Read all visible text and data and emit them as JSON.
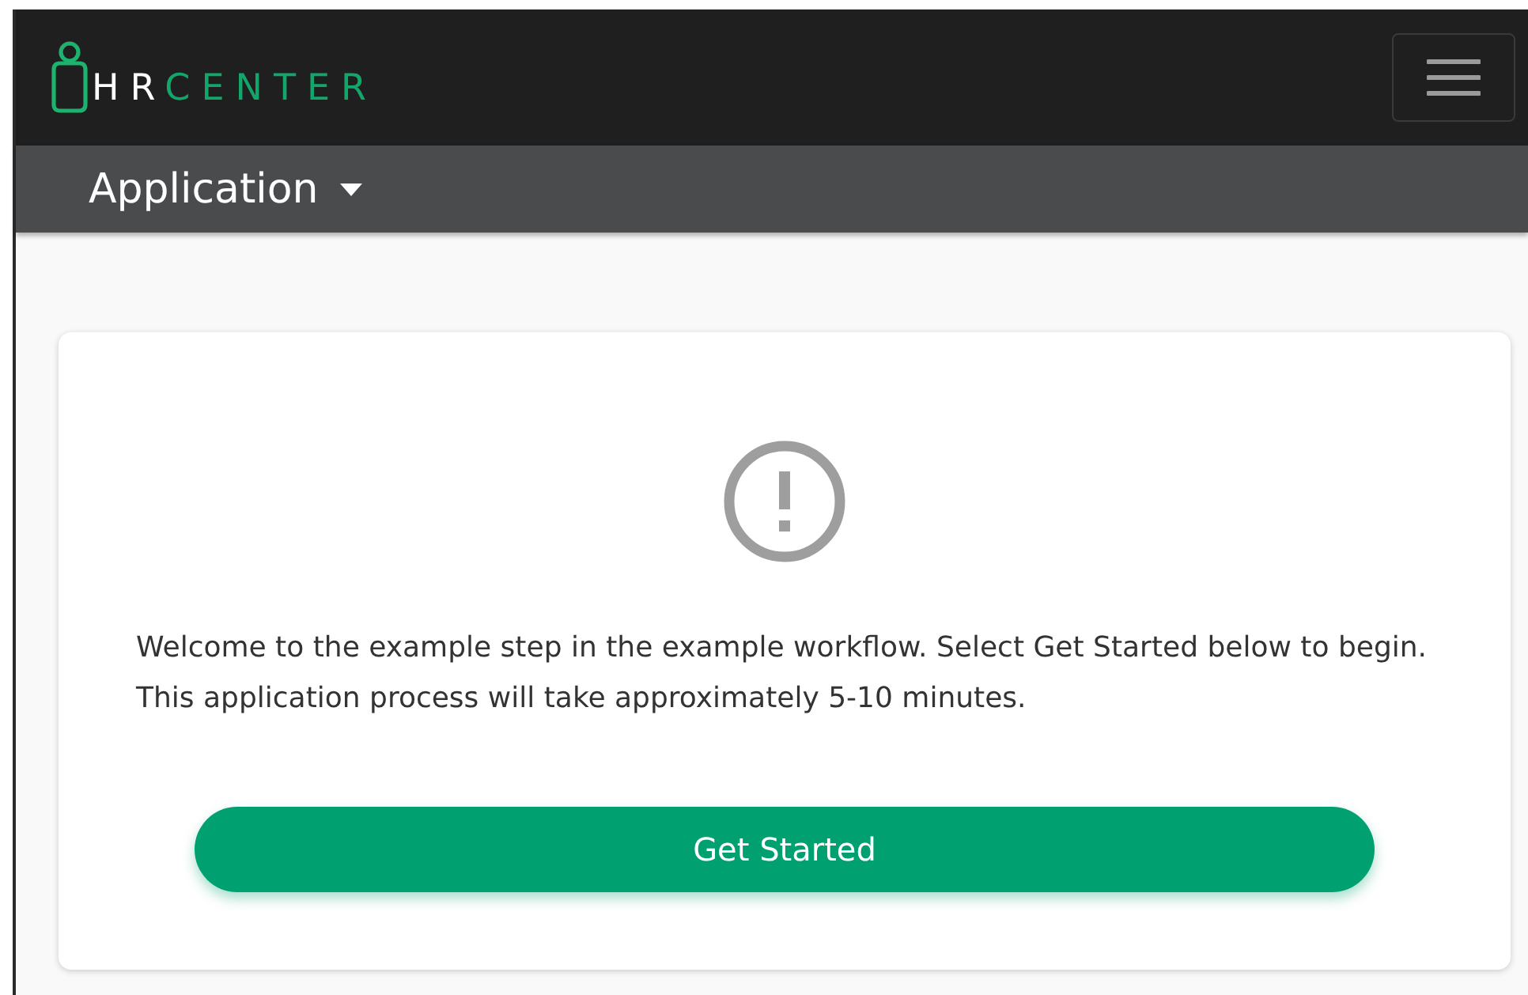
{
  "navbar": {
    "logo": {
      "prefix": "HR",
      "suffix": "CENTER"
    },
    "menu_expanded": false
  },
  "subnav": {
    "label": "Application"
  },
  "card": {
    "message": "Welcome to the example step in the example workflow. Select Get Started below to begin. This application process will take approximately 5-10 minutes.",
    "button": "Get Started"
  }
}
